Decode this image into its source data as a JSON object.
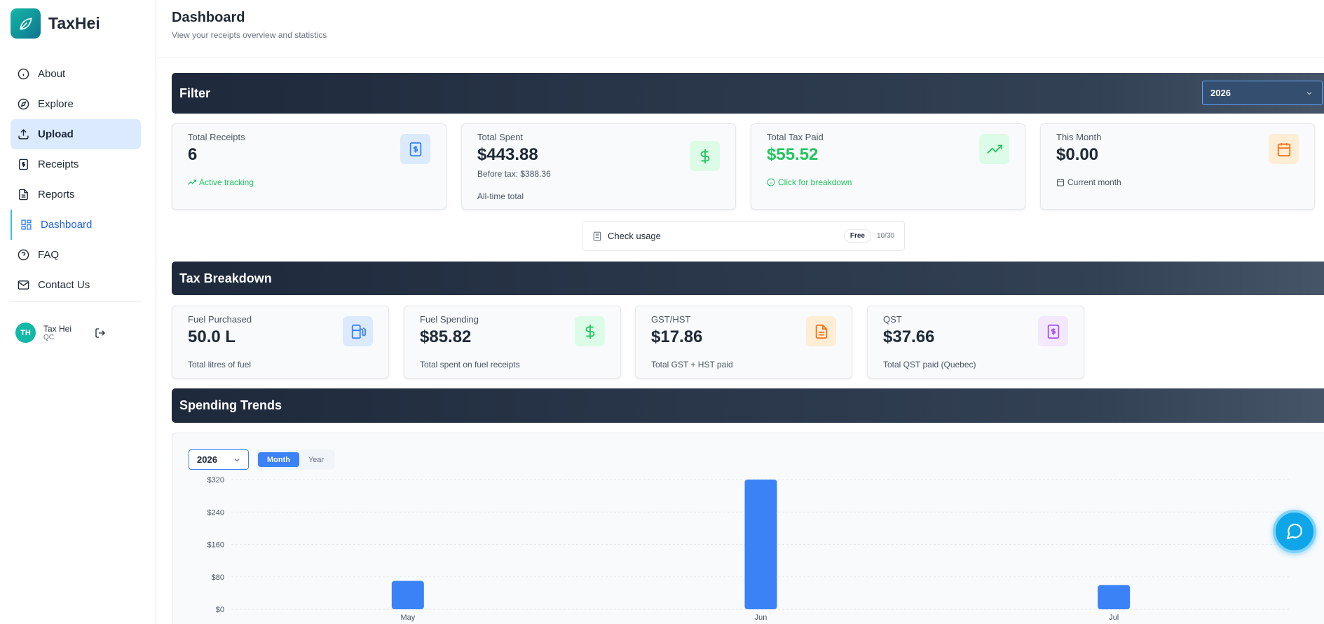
{
  "app": {
    "name": "TaxHei"
  },
  "nav": {
    "about": "About",
    "explore": "Explore",
    "upload": "Upload",
    "receipts": "Receipts",
    "reports": "Reports",
    "dashboard": "Dashboard",
    "faq": "FAQ",
    "contact": "Contact Us"
  },
  "user": {
    "initials": "TH",
    "name": "Tax Hei",
    "province": "QC"
  },
  "page": {
    "title": "Dashboard",
    "subtitle": "View your receipts overview and statistics"
  },
  "filter": {
    "title": "Filter",
    "year": "2026"
  },
  "stats": {
    "receipts": {
      "label": "Total Receipts",
      "value": "6",
      "sub": "Active tracking"
    },
    "spent": {
      "label": "Total Spent",
      "value": "$443.88",
      "before_tax": "Before tax: $388.36",
      "sub": "All-time total"
    },
    "tax": {
      "label": "Total Tax Paid",
      "value": "$55.52",
      "sub": "Click for breakdown"
    },
    "month": {
      "label": "This Month",
      "value": "$0.00",
      "sub": "Current month"
    }
  },
  "usage": {
    "label": "Check usage",
    "plan": "Free",
    "count": "10/30"
  },
  "tax_breakdown": {
    "title": "Tax Breakdown",
    "fuel_purchased": {
      "label": "Fuel Purchased",
      "value": "50.0 L",
      "sub": "Total litres of fuel"
    },
    "fuel_spending": {
      "label": "Fuel Spending",
      "value": "$85.82",
      "sub": "Total spent on fuel receipts"
    },
    "gst_hst": {
      "label": "GST/HST",
      "value": "$17.86",
      "sub": "Total GST + HST paid"
    },
    "qst": {
      "label": "QST",
      "value": "$37.66",
      "sub": "Total QST paid (Quebec)"
    }
  },
  "trends": {
    "title": "Spending Trends",
    "year": "2026",
    "toggle": {
      "month": "Month",
      "year": "Year",
      "selected": "Month"
    }
  },
  "colors": {
    "accent": "#3b82f6",
    "green": "#22c55e",
    "band": "#1e293b"
  },
  "chart_data": {
    "type": "bar",
    "categories": [
      "May",
      "Jun",
      "Jul"
    ],
    "values": [
      70,
      320,
      60
    ],
    "yticks": [
      "$0",
      "$80",
      "$160",
      "$240",
      "$320"
    ],
    "ylim": [
      0,
      320
    ],
    "grid": true
  }
}
